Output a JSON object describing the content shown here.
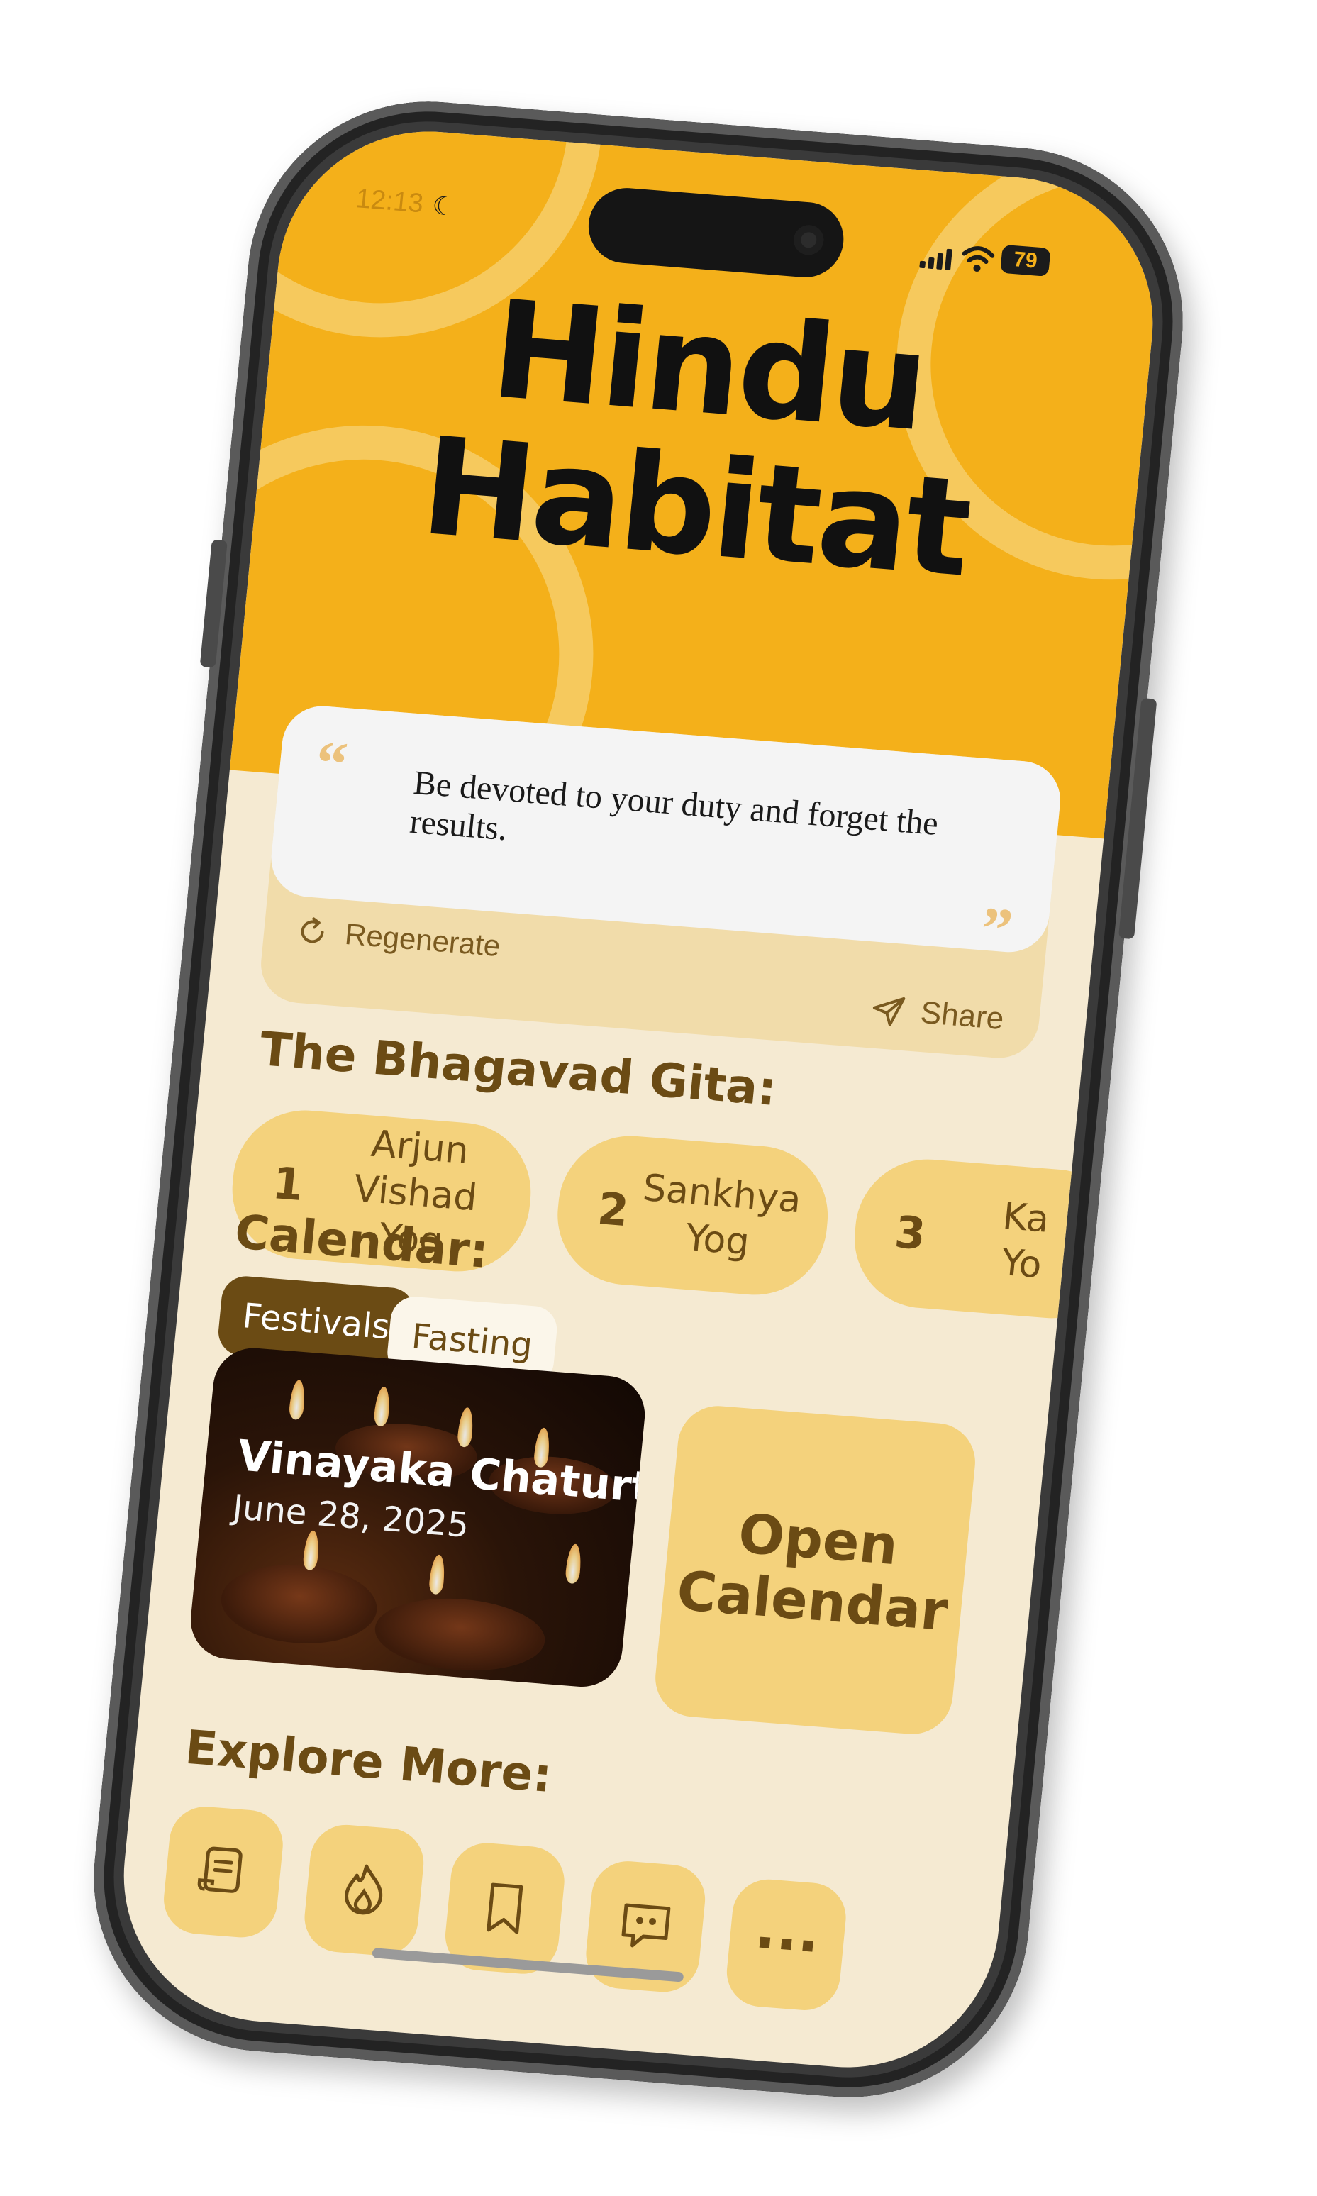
{
  "status_bar": {
    "time": "12:13",
    "moon_icon": "moon-icon",
    "signal_icon": "cellular-signal-icon",
    "wifi_icon": "wifi-icon",
    "battery": "79"
  },
  "header": {
    "title_line1": "Hindu",
    "title_line2": "Habitat"
  },
  "quote": {
    "open_icon": "quote-open-icon",
    "text": "Be devoted to your duty and forget the results.",
    "close_icon": "quote-close-icon",
    "regenerate_label": "Regenerate",
    "share_label": "Share"
  },
  "gita": {
    "title": "The Bhagavad Gita:",
    "chapters": [
      {
        "num": "1",
        "name": "Arjun Vishad\nYog"
      },
      {
        "num": "2",
        "name": "Sankhya\nYog"
      },
      {
        "num": "3",
        "name": "Ka\nYo"
      }
    ]
  },
  "calendar": {
    "title": "Calendar:",
    "tabs": [
      "Festivals",
      "Fasting"
    ],
    "selected_tab": "Festivals",
    "event": {
      "name": "Vinayaka Chaturthi",
      "date": "June 28, 2025"
    },
    "open_label": "Open\nCalendar"
  },
  "explore": {
    "title": "Explore More:",
    "items": [
      "scroll-icon",
      "fire-icon",
      "bookmark-icon",
      "chat-quote-icon",
      "more-icon"
    ],
    "more_glyph": "···"
  },
  "colors": {
    "accent": "#f4b01a",
    "primary_text": "#6b4b14",
    "card": "#f4d27c",
    "background": "#f5ead2"
  }
}
